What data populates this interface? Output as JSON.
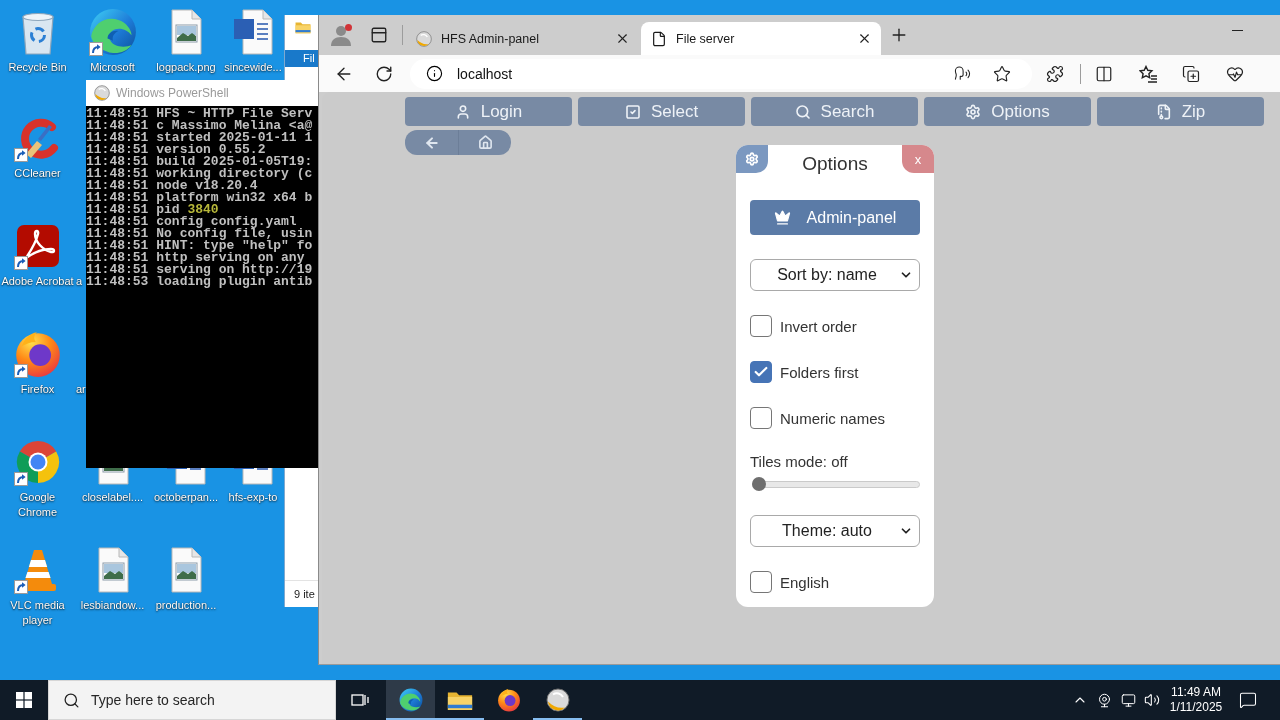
{
  "desktop": {
    "icons": [
      {
        "label": "Recycle Bin",
        "kind": "recycle",
        "shortcut": false
      },
      {
        "label": "Microsoft",
        "kind": "edge",
        "shortcut": true
      },
      {
        "label": "logpack.png",
        "kind": "image",
        "shortcut": false
      },
      {
        "label": "sincewide...",
        "kind": "word",
        "shortcut": false
      },
      {
        "label": "CCleaner",
        "kind": "ccleaner",
        "shortcut": true
      },
      {
        "label": "Adobe Acrobat",
        "kind": "acrobat",
        "shortcut": true
      },
      {
        "label": "a",
        "kind": "covered"
      },
      {
        "label": "Firefox",
        "kind": "firefox",
        "shortcut": true
      },
      {
        "label": "ar",
        "kind": "covered"
      },
      {
        "label": "Google Chrome",
        "kind": "chrome",
        "shortcut": true
      },
      {
        "label": "closelabel....",
        "kind": "image",
        "shortcut": false
      },
      {
        "label": "octoberpan...",
        "kind": "word",
        "shortcut": false
      },
      {
        "label": "hfs-exp-to",
        "kind": "word",
        "shortcut": false
      },
      {
        "label": "VLC media player",
        "kind": "vlc",
        "shortcut": true
      },
      {
        "label": "lesbiandow...",
        "kind": "image",
        "shortcut": false
      },
      {
        "label": "production...",
        "kind": "image",
        "shortcut": false
      }
    ]
  },
  "explorer_window": {
    "ribbon_tab": "Fil",
    "status": "9 ite"
  },
  "powershell": {
    "title": "Windows PowerShell",
    "lines": [
      {
        "time": "11:48:51",
        "message": "HFS ~ HTTP File Serv"
      },
      {
        "time": "11:48:51",
        "message": "c Massimo Melina <a@"
      },
      {
        "time": "11:48:51",
        "message": "started 2025-01-11 1"
      },
      {
        "time": "11:48:51",
        "message": "version 0.55.2"
      },
      {
        "time": "11:48:51",
        "message": "build 2025-01-05T19:"
      },
      {
        "time": "11:48:51",
        "message": "working directory (c"
      },
      {
        "time": "11:48:51",
        "message": "node v18.20.4"
      },
      {
        "time": "11:48:51",
        "message": "platform win32 x64 b"
      },
      {
        "time": "11:48:51",
        "message": "pid",
        "value": "3840"
      },
      {
        "time": "11:48:51",
        "message": "config config.yaml"
      },
      {
        "time": "11:48:51",
        "message": "No config file, usin"
      },
      {
        "time": "11:48:51",
        "message": "HINT: type \"help\" fo"
      },
      {
        "time": "11:48:51",
        "message": "http serving on any"
      },
      {
        "time": "11:48:51",
        "message": "serving on http://19"
      },
      {
        "time": "11:48:53",
        "message": "loading plugin antib"
      }
    ]
  },
  "browser": {
    "profile": {
      "notification": true
    },
    "tabs": [
      {
        "title": "HFS Admin-panel",
        "kind": "hfs",
        "selected": false
      },
      {
        "title": "File server",
        "kind": "page",
        "selected": true
      }
    ],
    "url": "localhost",
    "page": {
      "toolbar": [
        "Login",
        "Select",
        "Search",
        "Options",
        "Zip"
      ],
      "options_dialog": {
        "title": "Options",
        "close": "x",
        "admin_button": "Admin-panel",
        "controls": [
          {
            "kind": "select",
            "value": "Sort by: name"
          },
          {
            "kind": "checkbox",
            "label": "Invert order",
            "checked": false
          },
          {
            "kind": "checkbox",
            "label": "Folders first",
            "checked": true
          },
          {
            "kind": "checkbox",
            "label": "Numeric names",
            "checked": false
          },
          {
            "kind": "slider",
            "label": "Tiles mode: off",
            "level": 0
          },
          {
            "kind": "select",
            "value": "Theme: auto"
          },
          {
            "kind": "checkbox",
            "label": "English",
            "checked": false
          }
        ]
      }
    }
  },
  "taskbar": {
    "search": {
      "placeholder": "Type here to search"
    },
    "apps": [
      {
        "kind": "edge",
        "selected": true,
        "running": true
      },
      {
        "kind": "explorer",
        "selected": false,
        "running": true
      },
      {
        "kind": "firefox",
        "selected": false,
        "running": false
      },
      {
        "kind": "hfs",
        "selected": false,
        "running": true
      }
    ],
    "clock": {
      "time": "11:49 AM",
      "date": "1/11/2025"
    }
  }
}
